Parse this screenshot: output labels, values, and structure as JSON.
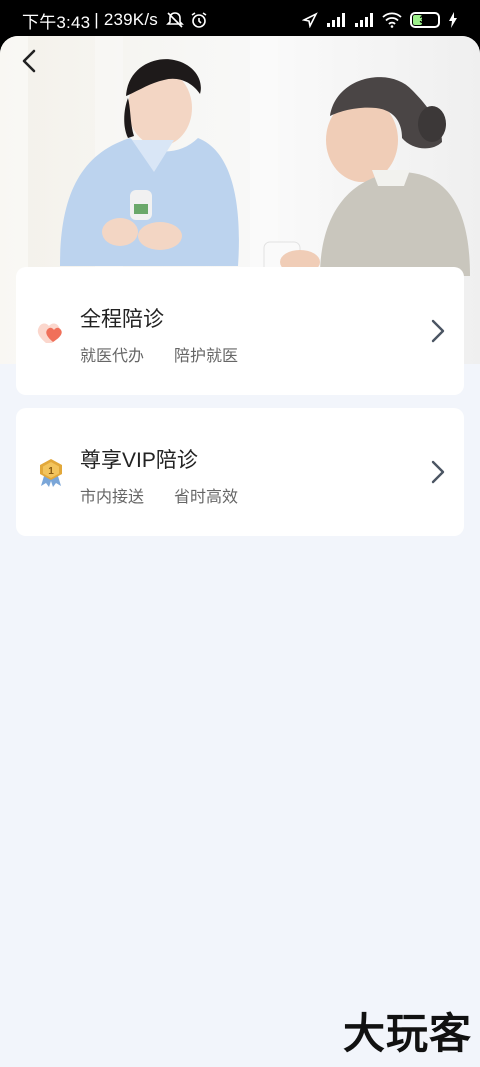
{
  "status_bar": {
    "time": "下午3:43",
    "net_speed": "| 239K/s",
    "battery": "36"
  },
  "header": {
    "back_icon": "chevron-left-icon"
  },
  "services": [
    {
      "title": "全程陪诊",
      "tags": [
        "就医代办",
        "陪护就医"
      ],
      "icon": "heart-icon"
    },
    {
      "title": "尊享VIP陪诊",
      "tags": [
        "市内接送",
        "省时高效"
      ],
      "icon": "medal-icon"
    }
  ],
  "watermark": "大玩客",
  "colors": {
    "accent_heart": "#f0705a",
    "medal_gold": "#e2a83a",
    "background": "#f2f5fb"
  }
}
